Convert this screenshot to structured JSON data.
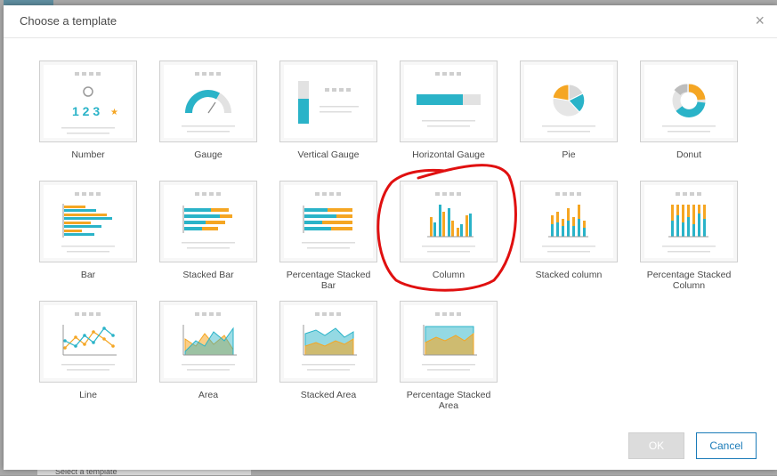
{
  "dialog": {
    "title": "Choose a template",
    "close_glyph": "×",
    "ok_label": "OK",
    "cancel_label": "Cancel"
  },
  "background": {
    "bottom_text": "Select a template"
  },
  "templates": [
    {
      "label": "Number",
      "icon": "number-icon",
      "number_text": "1 2 3"
    },
    {
      "label": "Gauge",
      "icon": "gauge-icon"
    },
    {
      "label": "Vertical Gauge",
      "icon": "vertical-gauge-icon"
    },
    {
      "label": "Horizontal Gauge",
      "icon": "horizontal-gauge-icon"
    },
    {
      "label": "Pie",
      "icon": "pie-chart-icon"
    },
    {
      "label": "Donut",
      "icon": "donut-chart-icon"
    },
    {
      "label": "Bar",
      "icon": "bar-chart-icon"
    },
    {
      "label": "Stacked Bar",
      "icon": "stacked-bar-chart-icon"
    },
    {
      "label": "Percentage Stacked Bar",
      "icon": "percentage-stacked-bar-chart-icon"
    },
    {
      "label": "Column",
      "icon": "column-chart-icon"
    },
    {
      "label": "Stacked column",
      "icon": "stacked-column-chart-icon"
    },
    {
      "label": "Percentage Stacked Column",
      "icon": "percentage-stacked-column-chart-icon"
    },
    {
      "label": "Line",
      "icon": "line-chart-icon"
    },
    {
      "label": "Area",
      "icon": "area-chart-icon"
    },
    {
      "label": "Stacked Area",
      "icon": "stacked-area-chart-icon"
    },
    {
      "label": "Percentage Stacked Area",
      "icon": "percentage-stacked-area-chart-icon"
    }
  ],
  "colors": {
    "teal": "#2ab3c8",
    "orange": "#f5a623",
    "gray": "#c9c9c9",
    "annotation_red": "#e01010",
    "cancel_blue": "#1a7bb8"
  }
}
